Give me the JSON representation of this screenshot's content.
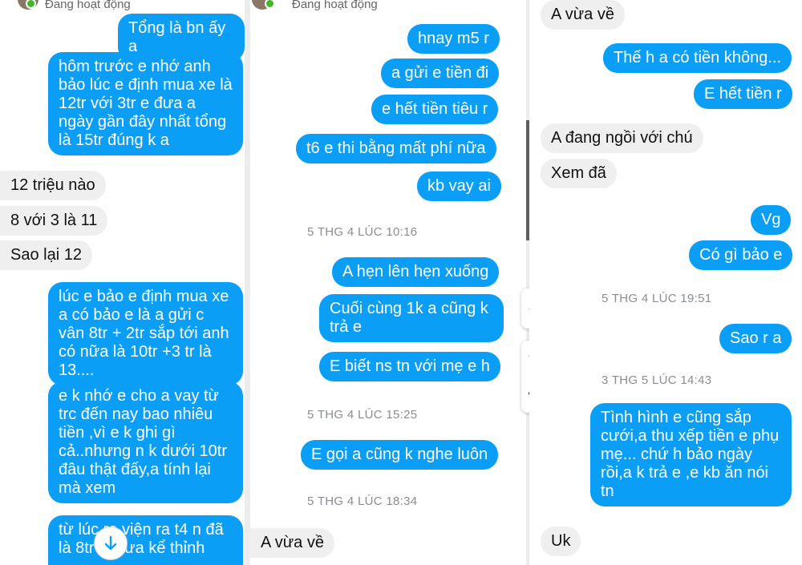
{
  "header": {
    "status_text": "Đang hoạt động"
  },
  "panel1": {
    "messages": [
      {
        "side": "me",
        "text": "Tổng là bn ấy a"
      },
      {
        "side": "me",
        "text": "hôm trước e nhớ anh bảo lúc e định mua xe là 12tr với 3tr e đưa a ngày gần đây nhất tổng là 15tr đúng k a"
      },
      {
        "side": "them",
        "text": "12 triệu nào"
      },
      {
        "side": "them",
        "text": "8 với 3 là 11"
      },
      {
        "side": "them",
        "text": "Sao lại 12"
      },
      {
        "side": "me",
        "text": "lúc e bảo e định mua xe a có bảo e là a gửi c vân 8tr + 2tr sắp tới anh có nữa là 10tr +3 tr là 13...."
      },
      {
        "side": "me",
        "text": "e k nhớ e cho a vay từ trc đến nay bao nhiêu tiền ,vì e k ghi gì cả..nhưng n k dưới 10tr đâu thật đấy,a tính lại mà xem"
      },
      {
        "side": "me",
        "text": "từ lúc ra viện ra t4 n đã là 8tr r,chưa kể thỉnh"
      }
    ]
  },
  "panel2": {
    "messages": [
      {
        "side": "me",
        "text": "hnay m5 r"
      },
      {
        "side": "me",
        "text": "a gửi e tiền đi"
      },
      {
        "side": "me",
        "text": "e hết tiền tiêu r"
      },
      {
        "side": "me",
        "text": "t6 e thi bằng mất phí nữa"
      },
      {
        "side": "me",
        "text": "kb vay ai"
      },
      {
        "side": "me",
        "text": "A hẹn lên hẹn xuống"
      },
      {
        "side": "me",
        "text": "Cuối cùng 1k a cũng k trả e"
      },
      {
        "side": "me",
        "text": "E biết ns tn với mẹ e h"
      },
      {
        "side": "me",
        "text": "E gọi a cũng k nghe luôn"
      },
      {
        "side": "them",
        "text": "A vừa về"
      }
    ],
    "timestamps": [
      "5 THG 4 LÚC 10:16",
      "5 THG 4 LÚC 15:25",
      "5 THG 4 LÚC 18:34"
    ]
  },
  "panel3": {
    "messages": [
      {
        "side": "them",
        "text": "A vừa về"
      },
      {
        "side": "me",
        "text": "Thế h a có tiền không..."
      },
      {
        "side": "me",
        "text": "E hết tiền r"
      },
      {
        "side": "them",
        "text": "A đang ngồi với chú"
      },
      {
        "side": "them",
        "text": "Xem đã"
      },
      {
        "side": "me",
        "text": "Vg"
      },
      {
        "side": "me",
        "text": "Có gì bảo e"
      },
      {
        "side": "me",
        "text": "Sao r a"
      },
      {
        "side": "me",
        "text": "Tình hình e cũng sắp cưới,a thu xếp tiền e phụ mẹ... chứ h bảo ngày rồi,a k trả e ,e kb ăn nói tn"
      },
      {
        "side": "them",
        "text": "Uk"
      }
    ],
    "timestamps": [
      "5 THG 4 LÚC 19:51",
      "3 THG 5 LÚC 14:43"
    ]
  },
  "colors": {
    "outgoing": "#0a9ef6",
    "incoming": "#efefef",
    "online": "#42b72a"
  },
  "icons": [
    "scroll-down-arrow-icon",
    "microphone-icon",
    "more-dots-icon"
  ]
}
